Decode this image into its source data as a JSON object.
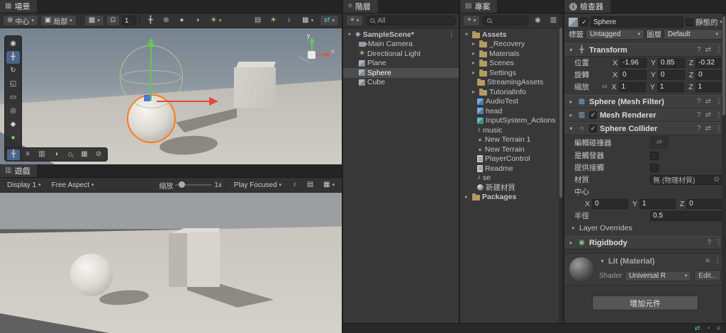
{
  "icons": {
    "caret": "▾",
    "fold_open": "▾",
    "fold_closed": "▸",
    "plus": "+",
    "more": "⋮",
    "help": "?",
    "check": "✓",
    "menu": "≡",
    "grid": "▦",
    "pivot": "⊕",
    "cube": "▣",
    "magnet": "Ω",
    "sun": "☀",
    "note": "♪",
    "view": "◉",
    "move": "╋",
    "rotate": "↻",
    "scale": "◱",
    "rect": "▭",
    "transform": "◎",
    "custom": "◆",
    "dot": "●",
    "picker": "⊙",
    "ban": "⊘",
    "swap": "⇄",
    "half": "◑",
    "rows": "▤",
    "panel": "▥",
    "infinity": "∞",
    "collider_edit": "▱",
    "terrain": "▲",
    "scene_asset": "◈",
    "spinner": "◔",
    "circle": "○",
    "fisheye": "◉",
    "info": "i"
  },
  "scene": {
    "tab": "場景",
    "toolbar": {
      "pivot_label": "中心",
      "space_label": "局部",
      "grid_size": "1"
    },
    "axis_labels": {
      "x": "x",
      "y": "y"
    }
  },
  "game": {
    "tab": "遊戲",
    "toolbar": {
      "display": "Display 1",
      "aspect": "Free Aspect",
      "zoom_label": "縮放",
      "zoom_value": "1x",
      "focus_mode": "Play Focused"
    }
  },
  "hierarchy": {
    "tab": "階層",
    "search_value": "All",
    "scene": "SampleScene*",
    "items": [
      {
        "label": "Main Camera"
      },
      {
        "label": "Directional Light"
      },
      {
        "label": "Plane"
      },
      {
        "label": "Sphere"
      },
      {
        "label": "Cube"
      }
    ]
  },
  "project": {
    "tab": "專案",
    "root": "Assets",
    "packages": "Packages",
    "items": [
      {
        "label": "_Recovery"
      },
      {
        "label": "Materials"
      },
      {
        "label": "Scenes"
      },
      {
        "label": "Settings"
      },
      {
        "label": "StreamingAssets"
      },
      {
        "label": "TutorialInfo"
      },
      {
        "label": "AudioTest"
      },
      {
        "label": "head"
      },
      {
        "label": "InputSystem_Actions"
      },
      {
        "label": "music"
      },
      {
        "label": "New Terrain 1"
      },
      {
        "label": "New Terrain"
      },
      {
        "label": "PlayerControl"
      },
      {
        "label": "Readme"
      },
      {
        "label": "se"
      },
      {
        "label": "新建材質"
      }
    ]
  },
  "inspector": {
    "tab": "檢查器",
    "axis": {
      "x": "X",
      "y": "Y",
      "z": "Z"
    },
    "header": {
      "name": "Sphere",
      "static_label": "靜態的",
      "tag_label": "標籤",
      "tag_value": "Untagged",
      "layer_label": "圖層",
      "layer_value": "Default"
    },
    "transform": {
      "title": "Transform",
      "position_label": "位置",
      "rotation_label": "旋轉",
      "scale_label": "縮放",
      "position": {
        "x": "-1.96",
        "y": "0.85",
        "z": "-0.32"
      },
      "rotation": {
        "x": "0",
        "y": "0",
        "z": "0"
      },
      "scale": {
        "x": "1",
        "y": "1",
        "z": "1"
      }
    },
    "mesh_filter_title": "Sphere (Mesh Filter)",
    "mesh_renderer_title": "Mesh Renderer",
    "collider": {
      "title": "Sphere Collider",
      "edit_label": "編輯碰撞器",
      "trigger_label": "是觸發器",
      "contacts_label": "提供接觸",
      "material_label": "材質",
      "material_value": "無 (物理材質)",
      "center_label": "中心",
      "center": {
        "x": "0",
        "y": "1",
        "z": "0"
      },
      "radius_label": "半徑",
      "radius": "0.5",
      "layer_overrides_label": "Layer Overrides"
    },
    "rigidbody_title": "Rigidbody",
    "material": {
      "title": "Lit (Material)",
      "shader_label": "Shader",
      "shader_value": "Universal R",
      "edit_label": "Edit..."
    },
    "add_component_label": "增加元件"
  }
}
